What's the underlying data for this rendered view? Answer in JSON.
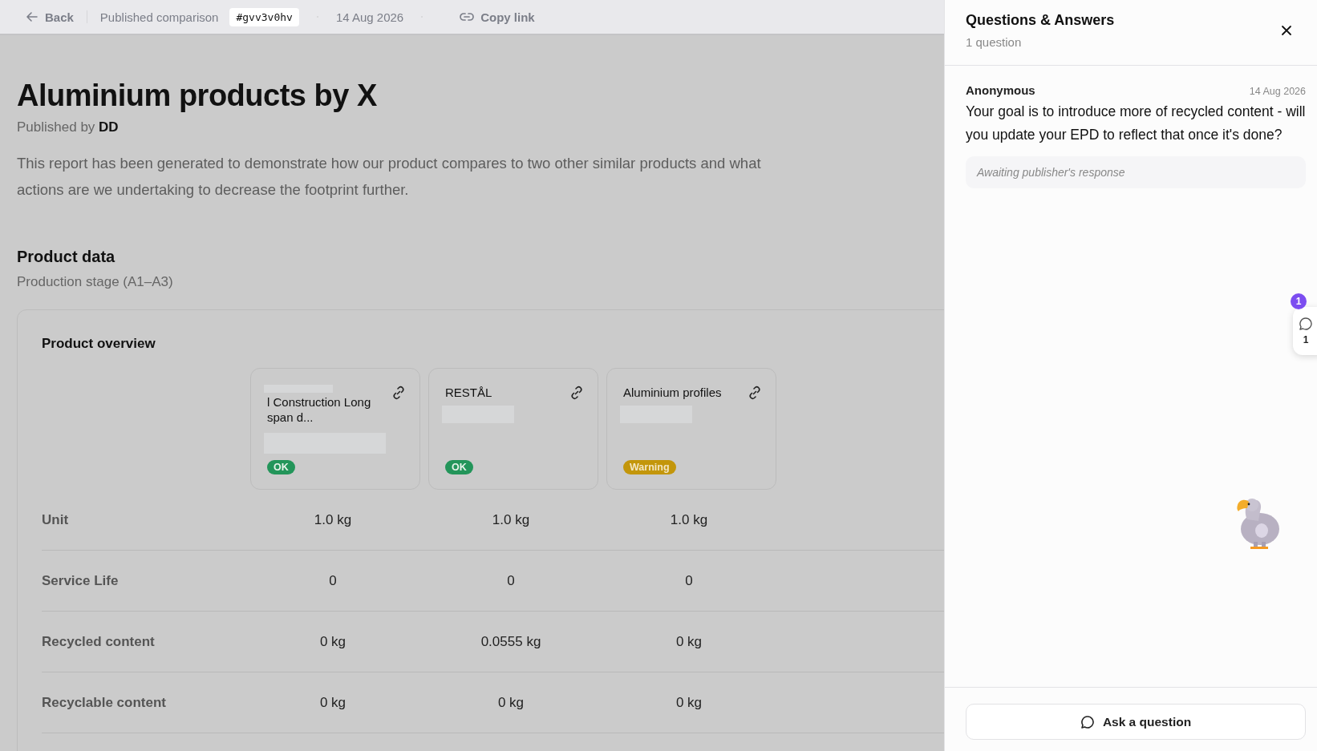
{
  "top_bar": {
    "back": "Back",
    "label": "Published comparison",
    "code": "#gvv3v0hv",
    "date": "14 Aug 2026",
    "copy": "Copy link"
  },
  "report": {
    "title": "Aluminium products by X",
    "published_prefix": "Published by",
    "publisher": "DD",
    "description": "This report has been generated to demonstrate how our product compares to two other similar products and what actions are we undertaking to decrease the footprint further."
  },
  "product_data": {
    "title": "Product data",
    "subtitle": "Production stage (A1–A3)",
    "overview": {
      "title": "Product overview",
      "products": [
        {
          "name": "l Construction Long span d...",
          "name_redacted": true,
          "redacted": true,
          "status": {
            "kind": "ok",
            "label": "OK"
          }
        },
        {
          "name": "RESTÅL",
          "name_redacted": false,
          "redacted": true,
          "status": {
            "kind": "ok",
            "label": "OK"
          }
        },
        {
          "name": "Aluminium profiles",
          "name_redacted": false,
          "redacted": true,
          "status": {
            "kind": "warning",
            "label": "Warning"
          }
        }
      ],
      "rows": [
        {
          "label": "Unit",
          "values": [
            "1.0 kg",
            "1.0 kg",
            "1.0 kg"
          ]
        },
        {
          "label": "Service Life",
          "values": [
            "0",
            "0",
            "0"
          ]
        },
        {
          "label": "Recycled content",
          "values": [
            "0 kg",
            "0.0555 kg",
            "0 kg"
          ]
        },
        {
          "label": "Recyclable content",
          "values": [
            "0 kg",
            "0 kg",
            "0 kg"
          ]
        }
      ]
    }
  },
  "qa_panel": {
    "title": "Questions & Answers",
    "count": "1 question",
    "questions": [
      {
        "author": "Anonymous",
        "date": "14 Aug 2026",
        "text": "Your goal is to introduce more of recycled content - will you update your EPD to reflect that once it's done?",
        "response": "Awaiting publisher's response"
      }
    ],
    "tab": {
      "badge": "1",
      "count": "1"
    },
    "ask_button": "Ask a question"
  }
}
